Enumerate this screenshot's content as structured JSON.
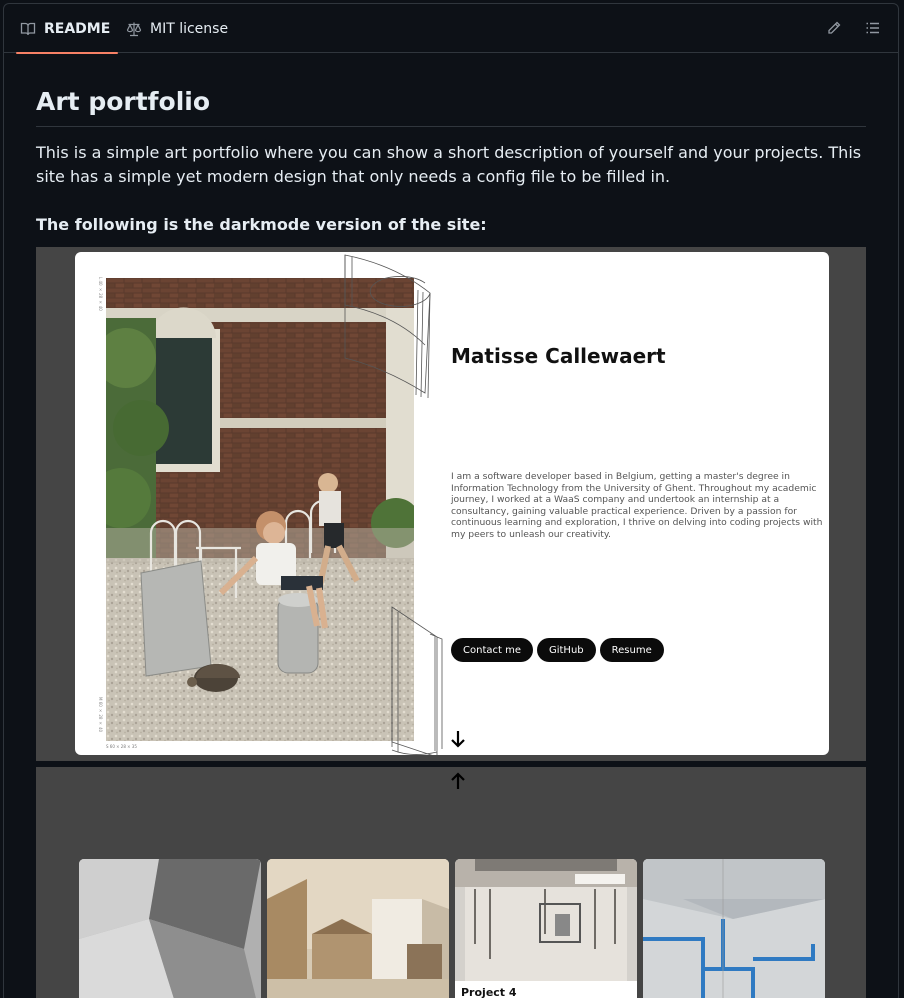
{
  "tabs": {
    "readme": "README",
    "license": "MIT license"
  },
  "readme": {
    "title": "Art portfolio",
    "description": "This is a simple art portfolio where you can show a short description of yourself and your projects. This site has a simple yet modern design that only needs a config file to be filled in.",
    "subtitle": "The following is the darkmode version of the site:"
  },
  "preview": {
    "name": "Matisse Callewaert",
    "bio": "I am a software developer based in Belgium, getting a master's degree in Information Technology from the University of Ghent. Throughout my academic journey, I worked at a WaaS company and undertook an internship at a consultancy, gaining valuable practical experience. Driven by a passion for continuous learning and exploration, I thrive on delving into coding projects with my peers to unleash our creativity.",
    "buttons": [
      "Contact me",
      "GitHub",
      "Resume"
    ],
    "side_top": "L 40 × 28 × 40",
    "side_bottom": "M 60 × 28 × 40",
    "dims": "S 60 × 28 × 35",
    "projects": [
      {
        "title": ""
      },
      {
        "title": ""
      },
      {
        "title": "Project 4"
      },
      {
        "title": ""
      }
    ]
  },
  "colors": {
    "accent": "#f78166",
    "bg": "#0d1117",
    "border": "#30363d"
  }
}
